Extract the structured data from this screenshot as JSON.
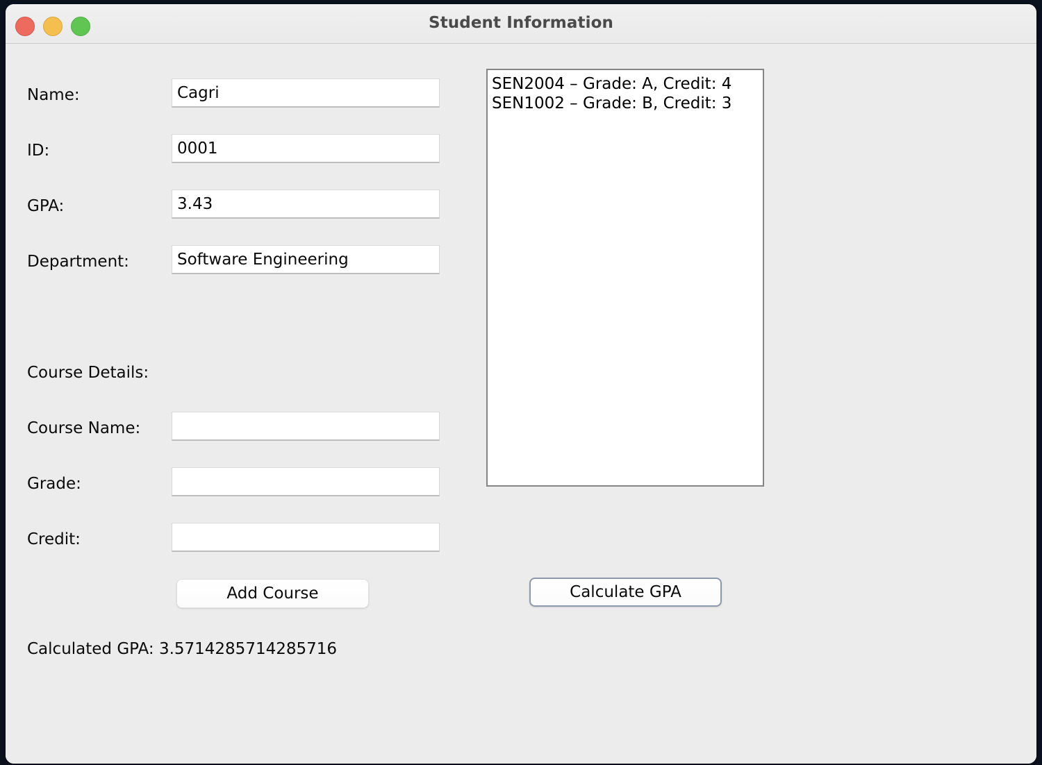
{
  "window": {
    "title": "Student Information",
    "controls": {
      "close": "close",
      "minimize": "minimize",
      "maximize": "maximize"
    }
  },
  "student_form": {
    "fields": [
      {
        "label": "Name:",
        "value": "Cagri",
        "placeholder": ""
      },
      {
        "label": "ID:",
        "value": "0001",
        "placeholder": ""
      },
      {
        "label": "GPA:",
        "value": "3.43",
        "placeholder": ""
      },
      {
        "label": "Department:",
        "value": "Software Engineering",
        "placeholder": ""
      }
    ]
  },
  "course_section": {
    "heading": "Course Details:",
    "fields": [
      {
        "label": "Course Name:",
        "value": "",
        "placeholder": ""
      },
      {
        "label": "Grade:",
        "value": "",
        "placeholder": ""
      },
      {
        "label": "Credit:",
        "value": "",
        "placeholder": ""
      }
    ],
    "add_button_label": "Add Course"
  },
  "course_list": {
    "entries": [
      "SEN2004 – Grade: A, Credit: 4",
      "SEN1002 – Grade: B, Credit: 3"
    ]
  },
  "gpa_panel": {
    "calculate_button_label": "Calculate GPA",
    "result_label": "Calculated GPA: 3.5714285714285716"
  },
  "colors": {
    "window_background": "#ececec",
    "titlebar_background": "#eaeaea",
    "field_background": "#ffffff",
    "list_border": "#858585",
    "default_button_border": "#8d99ad",
    "traffic_close": "#ed6a5e",
    "traffic_minimize": "#f5bf4f",
    "traffic_maximize": "#61c554",
    "text": "#0a0a0a",
    "title_text": "#4a4a4a"
  }
}
